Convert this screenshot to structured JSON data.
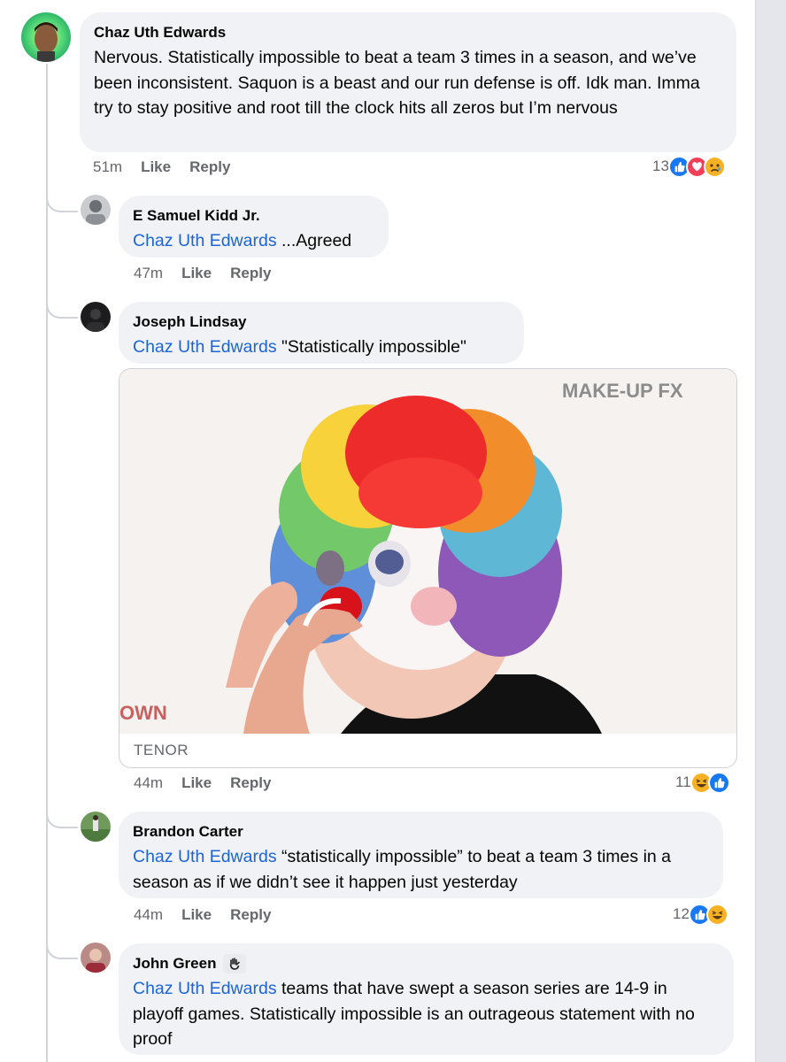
{
  "comments": [
    {
      "author": "Chaz Uth Edwards",
      "text": "Nervous. Statistically impossible to beat a team 3 times in a season, and we’ve been inconsistent. Saquon is a beast and our run defense is off. Idk man. Imma try to stay positive and root till the clock hits all zeros but I’m nervous",
      "time": "51m",
      "like": "Like",
      "reply": "Reply",
      "reaction_count": "13",
      "reactions": [
        "like",
        "love",
        "sad"
      ]
    }
  ],
  "replies": [
    {
      "author": "E Samuel Kidd Jr.",
      "mention": "Chaz Uth Edwards",
      "text": " ...Agreed",
      "time": "47m",
      "like": "Like",
      "reply": "Reply"
    },
    {
      "author": "Joseph Lindsay",
      "mention": "Chaz Uth Edwards",
      "text": " \"Statistically impossible\"",
      "time": "44m",
      "like": "Like",
      "reply": "Reply",
      "reaction_count": "11",
      "reactions": [
        "haha",
        "like"
      ],
      "gif": {
        "source_label": "TENOR",
        "watermark": "MAKE-UP FX",
        "corner_text": "OWN"
      }
    },
    {
      "author": "Brandon Carter",
      "mention": "Chaz Uth Edwards",
      "text": " “statistically  impossible” to beat a team 3 times in a season as if we didn’t see it happen just yesterday",
      "time": "44m",
      "like": "Like",
      "reply": "Reply",
      "reaction_count": "12",
      "reactions": [
        "like",
        "haha"
      ]
    },
    {
      "author": "John Green",
      "author_badge": "waving-hand-emoji",
      "mention": "Chaz Uth Edwards",
      "text": " teams that have swept a season series are 14-9 in playoff games. Statistically impossible is an outrageous statement with no proof"
    }
  ],
  "colors": {
    "mention": "#1b65d8",
    "bubble": "#f0f2f5",
    "meta": "#65676b",
    "like_reaction": "#1877f2",
    "love_reaction": "#f33e58",
    "haha_reaction": "#f7b125"
  }
}
